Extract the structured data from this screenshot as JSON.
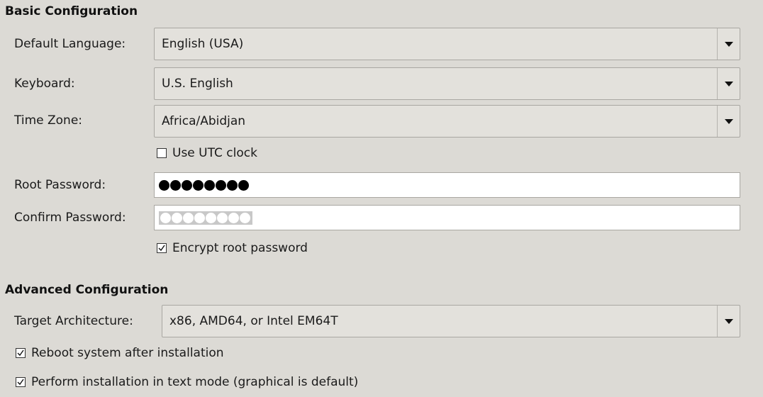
{
  "basic": {
    "title": "Basic Configuration",
    "language": {
      "label": "Default Language:",
      "value": "English (USA)"
    },
    "keyboard": {
      "label": "Keyboard:",
      "value": "U.S. English"
    },
    "timezone": {
      "label": "Time Zone:",
      "value": "Africa/Abidjan"
    },
    "utc_clock": {
      "label": "Use UTC clock",
      "checked": false
    },
    "root_password": {
      "label": "Root Password:",
      "masked_length": 8
    },
    "confirm_password": {
      "label": "Confirm Password:",
      "masked_length": 8,
      "selected": true
    },
    "encrypt_password": {
      "label": "Encrypt root password",
      "checked": true
    }
  },
  "advanced": {
    "title": "Advanced Configuration",
    "architecture": {
      "label": "Target Architecture:",
      "value": "x86, AMD64, or Intel EM64T"
    },
    "reboot": {
      "label": "Reboot system after installation",
      "checked": true
    },
    "text_mode": {
      "label": "Perform installation in text mode (graphical is default)",
      "checked": true
    }
  },
  "icons": {
    "dropdown": "chevron-down-icon",
    "check": "checkmark-icon"
  },
  "colors": {
    "background": "#dcdad5",
    "field_background": "#ffffff",
    "combo_background": "#e3e1dc"
  }
}
